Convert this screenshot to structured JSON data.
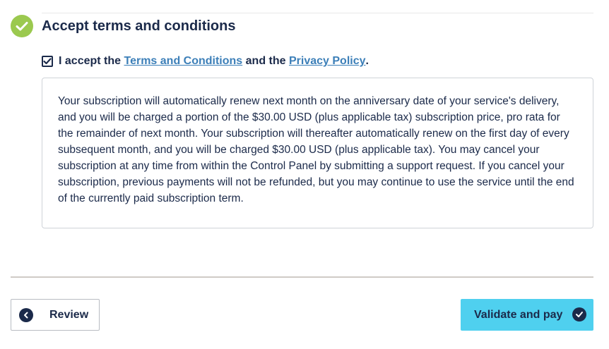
{
  "section": {
    "title": "Accept terms and conditions",
    "status_color": "#9bc94f"
  },
  "accept": {
    "checked": true,
    "prefix": "I accept the ",
    "terms_link": "Terms and Conditions",
    "middle": " and the ",
    "privacy_link": "Privacy Policy",
    "suffix": "."
  },
  "terms_text": "Your subscription will automatically renew next month on the anniversary date of your service's delivery, and you will be charged a portion of the $30.00 USD (plus applicable tax) subscription price, pro rata for the remainder of next month. Your subscription will thereafter automatically renew on the first day of every subsequent month, and you will be charged $30.00 USD (plus applicable tax). You may cancel your subscription at any time from within the Control Panel by submitting a support request. If you cancel your subscription, previous payments will not be refunded, but you may continue to use the service until the end of the currently paid subscription term.",
  "buttons": {
    "review": "Review",
    "validate": "Validate and pay",
    "primary_color": "#4fd0ef"
  },
  "icons": {
    "status": "check-circle-icon",
    "checkbox": "checkmark-icon",
    "review": "chevron-left-circle-icon",
    "validate": "check-circle-icon"
  }
}
